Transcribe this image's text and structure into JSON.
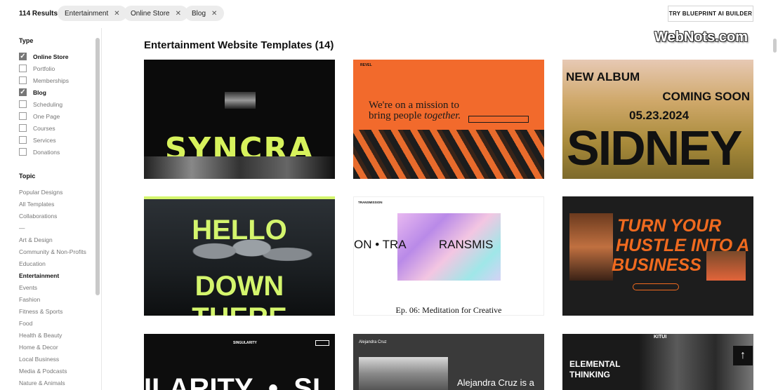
{
  "topbar": {
    "results": "114 Results",
    "chips": [
      "Entertainment",
      "Online Store",
      "Blog"
    ],
    "chip_remove_icon": "close-icon",
    "blueprint_button": "TRY BLUEPRINT AI BUILDER"
  },
  "sidebar": {
    "type_title": "Type",
    "types": [
      {
        "label": "Online Store",
        "checked": true
      },
      {
        "label": "Portfolio",
        "checked": false
      },
      {
        "label": "Memberships",
        "checked": false
      },
      {
        "label": "Blog",
        "checked": true
      },
      {
        "label": "Scheduling",
        "checked": false
      },
      {
        "label": "One Page",
        "checked": false
      },
      {
        "label": "Courses",
        "checked": false
      },
      {
        "label": "Services",
        "checked": false
      },
      {
        "label": "Donations",
        "checked": false
      }
    ],
    "topic_title": "Topic",
    "topics": [
      "Popular Designs",
      "All Templates",
      "Collaborations",
      "—",
      "Art & Design",
      "Community & Non-Profits",
      "Education",
      "Entertainment",
      "Events",
      "Fashion",
      "Fitness & Sports",
      "Food",
      "Health & Beauty",
      "Home & Decor",
      "Local Business",
      "Media & Podcasts",
      "Nature & Animals"
    ],
    "active_topic": "Entertainment"
  },
  "main": {
    "heading": "Entertainment Website Templates (14)",
    "watermark": "WebNots.com",
    "cards": {
      "syncra": {
        "word": "SYNCRA"
      },
      "revel": {
        "brand": "REVEL",
        "line1": "We're on a mission to",
        "line2a": "bring people ",
        "line2b": "together."
      },
      "sidney": {
        "album": "NEW ALBUM",
        "soon": "COMING SOON",
        "date": "05.23.2024",
        "name": "SIDNEY"
      },
      "hello": {
        "line1": "HELLO",
        "line2": "DOWN THERE"
      },
      "transmission": {
        "brand": "TRANSMISSION",
        "marquee": "ON • TRA          RANSMIS",
        "episode": "Ep. 06: Meditation for Creative"
      },
      "hustle": {
        "line1": "TURN YOUR",
        "line2": "HUSTLE INTO A",
        "line3": "BUSINESS"
      },
      "singularity": {
        "brand": "SINGULARITY",
        "big": "ILARITY  •  SI"
      },
      "alejandra": {
        "brand": "Alejandra Cruz",
        "headline": "Alejandra Cruz is a"
      },
      "kitui": {
        "brand": "KITUI",
        "line1": "ELEMENTAL",
        "line2": "THINKING"
      }
    }
  },
  "colors": {
    "revel_orange": "#f26a2c",
    "hello_green": "#d4f56d",
    "hustle_orange": "#f06a1f"
  },
  "back_to_top_icon": "arrow-up-icon"
}
